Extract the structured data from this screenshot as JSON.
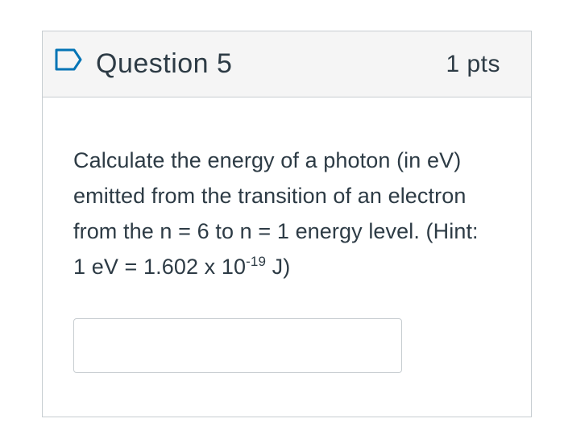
{
  "question": {
    "title": "Question 5",
    "points": "1 pts",
    "flag_icon": "bookmark-flag-icon",
    "text_line1": "Calculate the energy of a photon (in eV)",
    "text_line2": "emitted from the transition of an electron",
    "text_line3": "from the n = 6 to n = 1 energy level. (Hint:",
    "text_line4_pre": "1 eV = 1.602 x 10",
    "text_line4_exp": "-19",
    "text_line4_post": " J)"
  },
  "answer": {
    "value": "",
    "placeholder": ""
  },
  "colors": {
    "header_bg": "#f5f5f5",
    "border": "#c7cdd1",
    "text": "#2d3b45",
    "flag": "#0374b5"
  }
}
